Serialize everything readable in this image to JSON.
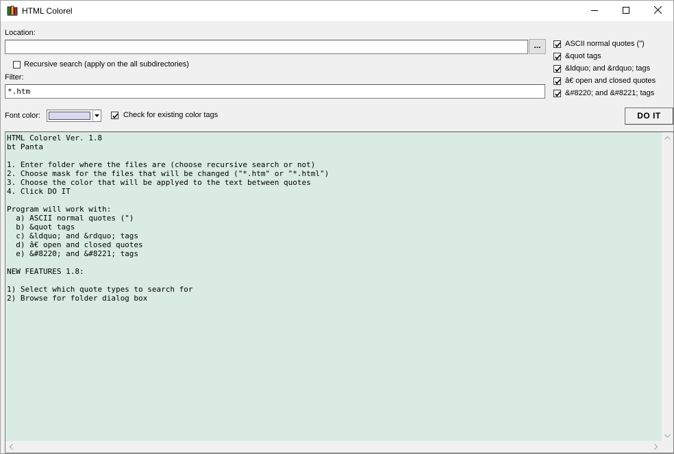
{
  "window": {
    "title": "HTML Colorel",
    "minimize_icon": "minimize-icon",
    "maximize_icon": "maximize-icon",
    "close_icon": "close-icon"
  },
  "location": {
    "label": "Location:",
    "value": "",
    "browse_label": "..."
  },
  "recursive": {
    "label": "Recursive search (apply on the all subdirectories)",
    "checked": false
  },
  "filter": {
    "label": "Filter:",
    "value": "*.htm"
  },
  "quote_types": [
    {
      "label": "ASCII normal quotes (\")",
      "checked": true
    },
    {
      "label": "&quot tags",
      "checked": true
    },
    {
      "label": "&ldquo; and &rdquo; tags",
      "checked": true
    },
    {
      "label": "â€ open and closed quotes",
      "checked": true
    },
    {
      "label": "&#8220; and &#8221; tags",
      "checked": true
    }
  ],
  "font_color": {
    "label": "Font color:",
    "swatch_color": "#d8d8f0"
  },
  "check_existing": {
    "label": "Check for existing color tags",
    "checked": true
  },
  "do_it_label": "DO IT",
  "info_text": "HTML Colorel Ver. 1.8\nbt Panta\n\n1. Enter folder where the files are (choose recursive search or not)\n2. Choose mask for the files that will be changed (\"*.htm\" or \"*.html\")\n3. Choose the color that will be applyed to the text between quotes\n4. Click DO IT\n\nProgram will work with:\n  a) ASCII normal quotes (\")\n  b) &quot tags\n  c) &ldquo; and &rdquo; tags\n  d) â€ open and closed quotes\n  e) &#8220; and &#8221; tags\n\nNEW FEATURES 1.8:\n\n1) Select which quote types to search for\n2) Browse for folder dialog box",
  "colors": {
    "text_area_bg": "#d9ebe2",
    "window_bg": "#f0f0f0"
  }
}
